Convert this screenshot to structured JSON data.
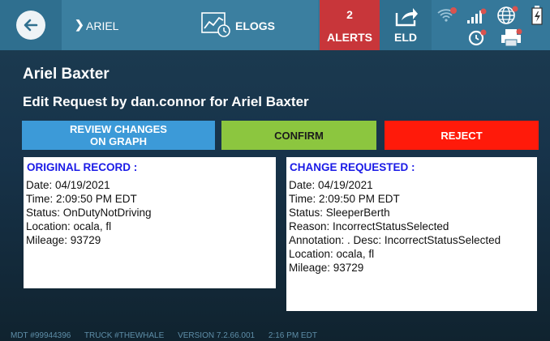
{
  "topbar": {
    "breadcrumb": {
      "chevron": "❯",
      "label": "ARIEL"
    },
    "elogs": {
      "label": "ELOGS",
      "icon": "chart-icon"
    },
    "alerts": {
      "count": "2",
      "label": "ALERTS",
      "color": "#c8363a"
    },
    "eld": {
      "label": "ELD",
      "icon": "share-icon"
    },
    "status_icons": [
      "wifi-off-icon",
      "signal-icon",
      "globe-icon",
      "battery-icon",
      "sync-icon",
      "printer-icon"
    ]
  },
  "header": {
    "driver_name": "Ariel Baxter",
    "subtitle": "Edit Request by dan.connor for Ariel Baxter"
  },
  "actions": {
    "review_line1": "REVIEW CHANGES",
    "review_line2": "ON GRAPH",
    "confirm": "CONFIRM",
    "reject": "REJECT"
  },
  "original": {
    "heading": "ORIGINAL RECORD :",
    "lines": [
      "Date: 04/19/2021",
      "Time: 2:09:50 PM EDT",
      "Status: OnDutyNotDriving",
      "Location: ocala, fl",
      "Mileage: 93729"
    ]
  },
  "requested": {
    "heading": "CHANGE REQUESTED :",
    "lines": [
      "Date: 04/19/2021",
      "Time: 2:09:50 PM EDT",
      "Status: SleeperBerth",
      "Reason: IncorrectStatusSelected",
      "Annotation:  . Desc: IncorrectStatusSelected",
      "Location: ocala, fl",
      "Mileage: 93729"
    ]
  },
  "footer": {
    "mdt": "MDT #99944396",
    "truck": "TRUCK #THEWHALE",
    "version": "VERSION  7.2.66.001",
    "time": "2:16 PM EDT"
  }
}
